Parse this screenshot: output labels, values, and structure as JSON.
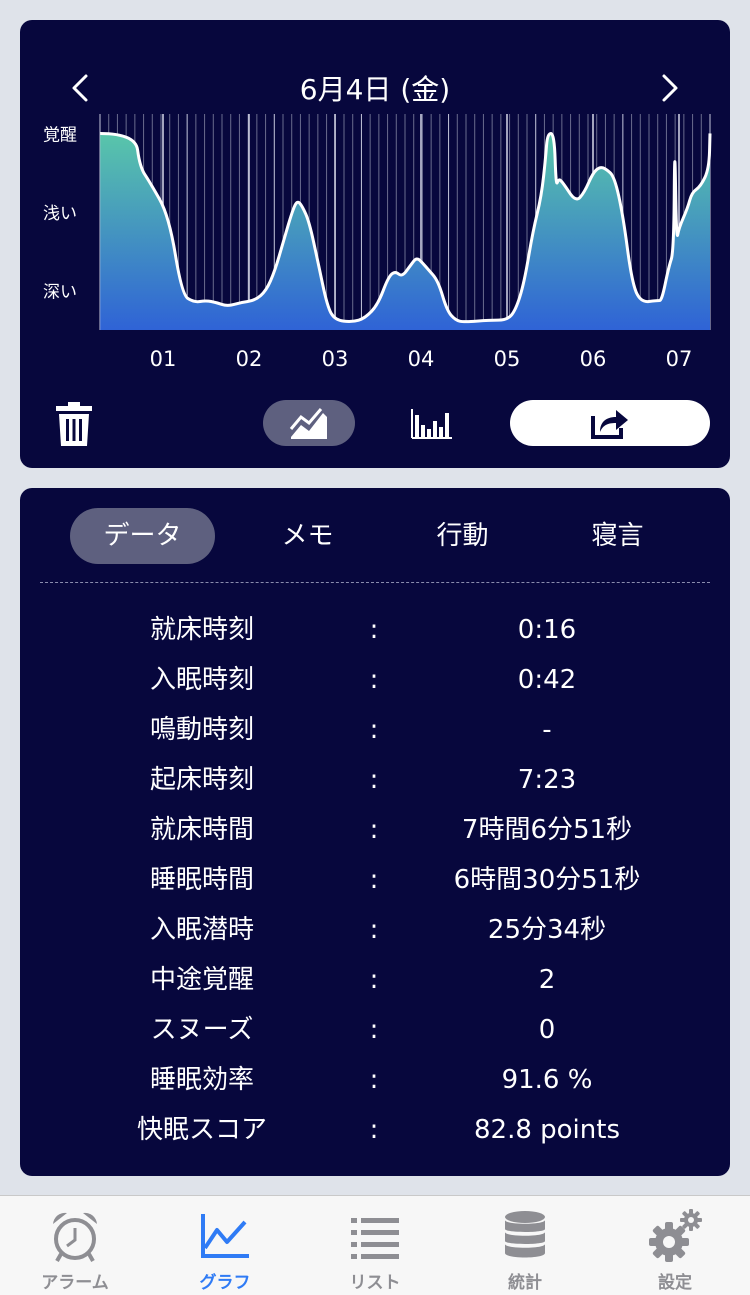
{
  "header": {
    "prev_icon": "chevron-left-icon",
    "date": "6月4日 (金)",
    "next_icon": "chevron-right-icon"
  },
  "chart_data": {
    "type": "area",
    "y_levels": [
      "覚醒",
      "浅い",
      "深い"
    ],
    "x_tick_labels": [
      "01",
      "02",
      "03",
      "04",
      "05",
      "06",
      "07"
    ],
    "x_range": [
      0.27,
      7.38
    ],
    "y_range": [
      0,
      1
    ],
    "y_level_values": {
      "覚醒": 1.0,
      "浅い": 0.6,
      "深い": 0.2
    },
    "vertical_grid": true,
    "colors": {
      "top": "#59c6aa",
      "bottom": "#2f63d6",
      "line": "#ffffff"
    },
    "series": [
      {
        "x": [
          0.27,
          0.68,
          0.73,
          0.85,
          1.07,
          1.22,
          1.36,
          1.5,
          1.62,
          1.75,
          1.9,
          2.07,
          2.2,
          2.3,
          2.4,
          2.5,
          2.56,
          2.62,
          2.7,
          2.8,
          2.91,
          3.0,
          3.2,
          3.35,
          3.5,
          3.62,
          3.7,
          3.78,
          3.88,
          3.95,
          4.02,
          4.08,
          4.2,
          4.3,
          4.4,
          4.5,
          4.8,
          5.0,
          5.1,
          5.2,
          5.3,
          5.4,
          5.45,
          5.47,
          5.55,
          5.57,
          5.6,
          5.65,
          5.8,
          5.9,
          6.0,
          6.08,
          6.15,
          6.25,
          6.35,
          6.45,
          6.55,
          6.75,
          6.8,
          6.88,
          6.94,
          6.95,
          6.97,
          7.0,
          7.1,
          7.15,
          7.25,
          7.35,
          7.38
        ],
        "y": [
          1.0,
          1.0,
          0.83,
          0.75,
          0.58,
          0.18,
          0.14,
          0.15,
          0.14,
          0.12,
          0.14,
          0.15,
          0.2,
          0.3,
          0.45,
          0.6,
          0.66,
          0.63,
          0.55,
          0.35,
          0.12,
          0.05,
          0.04,
          0.06,
          0.13,
          0.27,
          0.3,
          0.27,
          0.33,
          0.37,
          0.34,
          0.31,
          0.25,
          0.1,
          0.05,
          0.04,
          0.05,
          0.05,
          0.1,
          0.24,
          0.5,
          0.68,
          0.88,
          1.0,
          1.0,
          0.73,
          0.77,
          0.75,
          0.65,
          0.7,
          0.8,
          0.83,
          0.82,
          0.78,
          0.58,
          0.25,
          0.14,
          0.15,
          0.15,
          0.32,
          0.4,
          1.0,
          0.45,
          0.52,
          0.62,
          0.7,
          0.73,
          0.82,
          1.0
        ]
      }
    ]
  },
  "toolbar": {
    "delete_icon": "trash-icon",
    "line_graph_icon": "line-graph-icon",
    "bar_graph_icon": "bar-graph-icon",
    "share_icon": "share-icon"
  },
  "tabs": [
    {
      "label": "データ",
      "selected": true
    },
    {
      "label": "メモ",
      "selected": false
    },
    {
      "label": "行動",
      "selected": false
    },
    {
      "label": "寝言",
      "selected": false
    }
  ],
  "separator": ":",
  "rows": [
    {
      "label": "就床時刻",
      "value": "0:16"
    },
    {
      "label": "入眠時刻",
      "value": "0:42"
    },
    {
      "label": "鳴動時刻",
      "value": "-"
    },
    {
      "label": "起床時刻",
      "value": "7:23"
    },
    {
      "label": "就床時間",
      "value": "7時間6分51秒"
    },
    {
      "label": "睡眠時間",
      "value": "6時間30分51秒"
    },
    {
      "label": "入眠潜時",
      "value": "25分34秒"
    },
    {
      "label": "中途覚醒",
      "value": "2"
    },
    {
      "label": "スヌーズ",
      "value": "0"
    },
    {
      "label": "睡眠効率",
      "value": "91.6 %"
    },
    {
      "label": "快眠スコア",
      "value": "82.8 points"
    }
  ],
  "tabbar": {
    "active_color": "#2f7bf5",
    "items": [
      {
        "label": "アラーム",
        "icon": "alarm-clock-icon",
        "active": false
      },
      {
        "label": "グラフ",
        "icon": "graph-icon",
        "active": true
      },
      {
        "label": "リスト",
        "icon": "list-icon",
        "active": false
      },
      {
        "label": "統計",
        "icon": "database-icon",
        "active": false
      },
      {
        "label": "設定",
        "icon": "gear-icon",
        "active": false
      }
    ]
  }
}
